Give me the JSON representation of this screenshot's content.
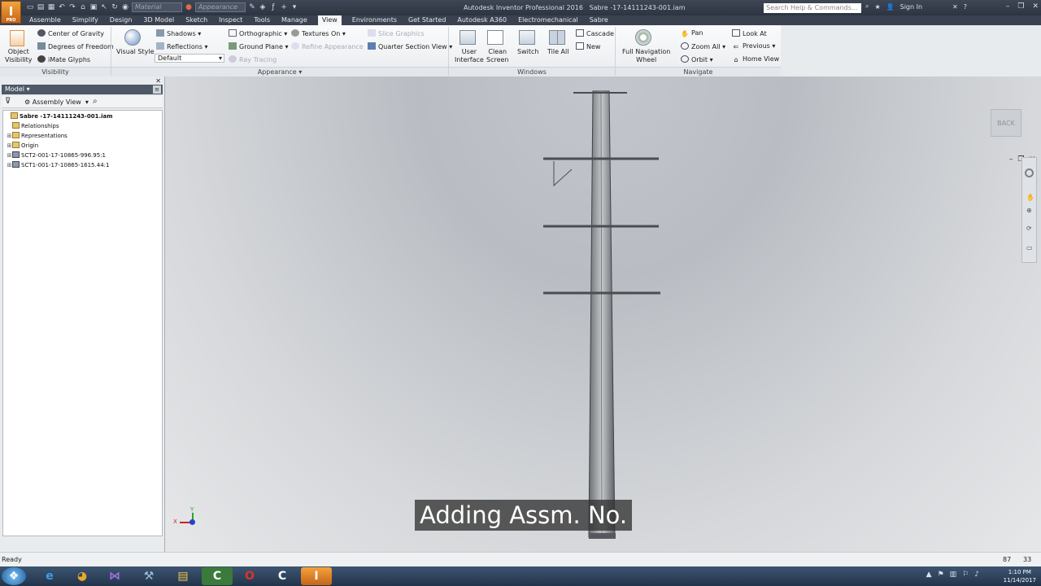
{
  "app": {
    "logo": "I",
    "logo_sub": "PRO",
    "title": "Autodesk Inventor Professional 2016",
    "document": "Sabre -17-14111243-001.iam"
  },
  "qat": {
    "material": "Material",
    "appearance": "Appearance"
  },
  "search": {
    "placeholder": "Search Help & Commands..."
  },
  "account": {
    "signin": "Sign In"
  },
  "tabs": [
    "Assemble",
    "Simplify",
    "Design",
    "3D Model",
    "Sketch",
    "Inspect",
    "Tools",
    "Manage",
    "View",
    "Environments",
    "Get Started",
    "Autodesk A360",
    "Electromechanical",
    "Sabre"
  ],
  "active_tab": "View",
  "ribbon": {
    "visibility": {
      "object_visibility": "Object\nVisibility",
      "center_of_gravity": "Center of Gravity",
      "degrees_of_freedom": "Degrees of Freedom",
      "imate_glyphs": "iMate Glyphs",
      "panel": "Visibility"
    },
    "appearance": {
      "visual_style": "Visual Style",
      "shadows": "Shadows",
      "reflections": "Reflections",
      "style_value": "Default",
      "ray_tracing": "Ray Tracing",
      "orthographic": "Orthographic",
      "ground_plane": "Ground Plane",
      "textures_on": "Textures On",
      "refine_appearance": "Refine Appearance",
      "slice_graphics": "Slice Graphics",
      "quarter_section": "Quarter Section View",
      "panel": "Appearance"
    },
    "windows": {
      "user_interface": "User\nInterface",
      "clean_screen": "Clean\nScreen",
      "switch": "Switch",
      "tile_all": "Tile All",
      "cascade": "Cascade",
      "new": "New",
      "panel": "Windows"
    },
    "navigate": {
      "full_nav_wheel": "Full Navigation\nWheel",
      "pan": "Pan",
      "zoom_all": "Zoom All",
      "orbit": "Orbit",
      "look_at": "Look At",
      "previous": "Previous",
      "home_view": "Home View",
      "panel": "Navigate"
    }
  },
  "browser": {
    "title": "Model",
    "view": "Assembly View",
    "nodes": [
      {
        "label": "Sabre -17-14111243-001.iam",
        "bold": true,
        "indent": 0
      },
      {
        "label": "Relationships",
        "indent": 1
      },
      {
        "label": "Representations",
        "indent": 1
      },
      {
        "label": "Origin",
        "indent": 1
      },
      {
        "label": "SCT2-001-17-10865-996.95:1",
        "indent": 1
      },
      {
        "label": "SCT1-001-17-10865-1615.44:1",
        "indent": 1
      }
    ]
  },
  "viewport": {
    "viewcube_label": "BACK",
    "caption": "Adding Assm. No."
  },
  "status": {
    "text": "Ready",
    "num1": "87",
    "num2": "33"
  },
  "taskbar": {
    "time": "1:10 PM",
    "date": "11/14/2017"
  }
}
